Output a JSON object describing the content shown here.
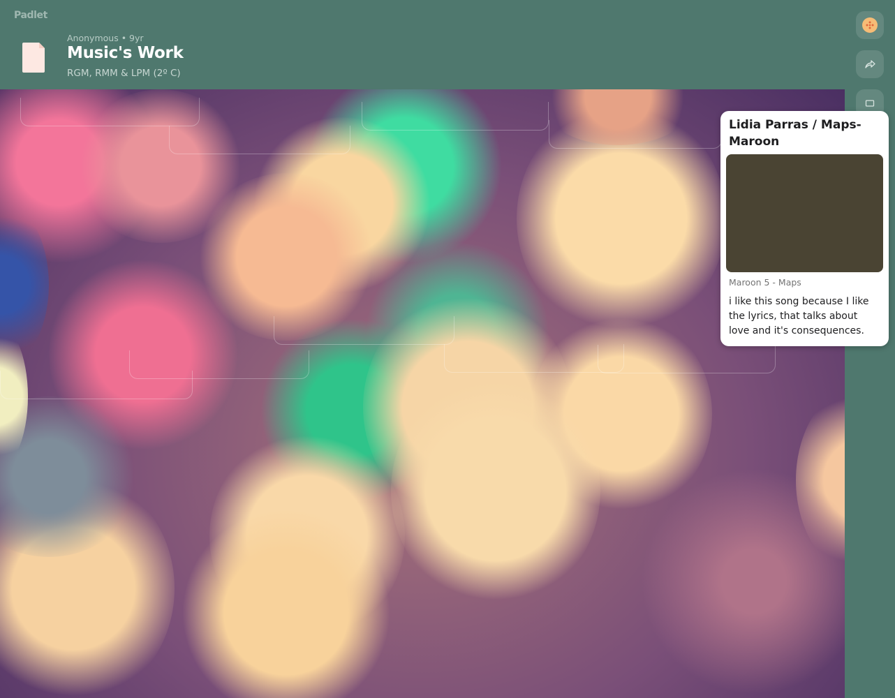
{
  "app": {
    "brand": "Padlet"
  },
  "header": {
    "author": "Anonymous",
    "separator": "•",
    "age": "9yr",
    "title": "Music's Work",
    "subtitle": "RGM, RMM & LPM (2º C)"
  },
  "rail": {
    "buttons": [
      {
        "icon": "avatar-icon"
      },
      {
        "icon": "share-icon"
      },
      {
        "icon": "slideshow-icon"
      }
    ]
  },
  "post": {
    "title": "Lidia Parras / Maps-Maroon",
    "attachment_caption": "Maroon 5 - Maps",
    "body": "i like this song because I like the lyrics, that talks about love and it's consequences."
  },
  "colors": {
    "header_bg": "#4f786e",
    "card_bg": "#ffffff",
    "media_bg": "#4a4433",
    "avatar": "#f6bc76"
  }
}
